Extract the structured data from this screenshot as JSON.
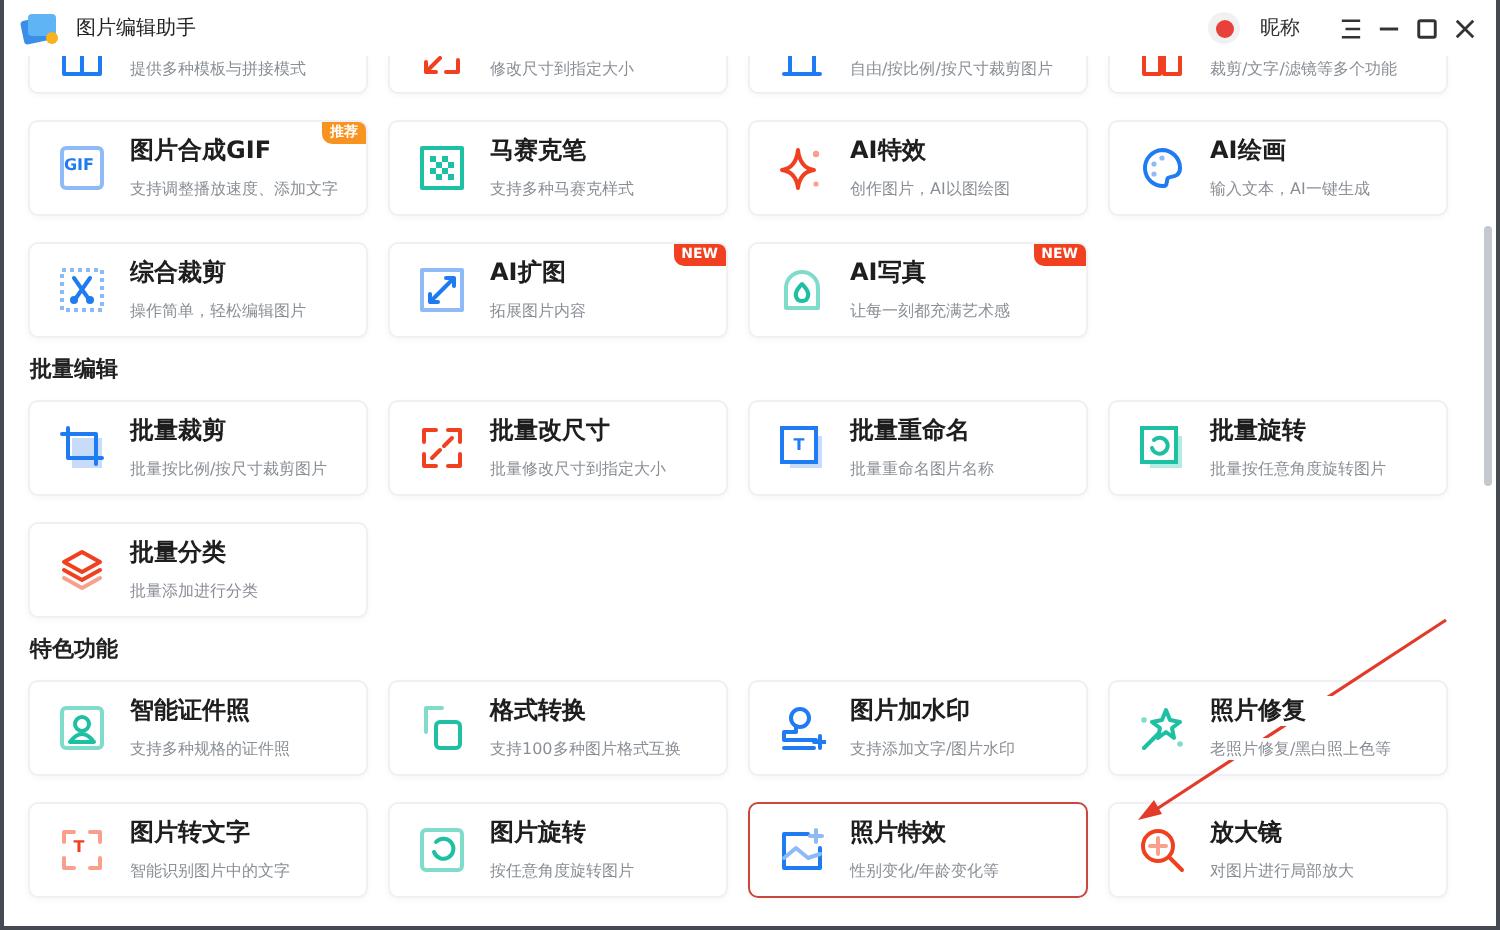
{
  "window": {
    "title": "图片编辑助手",
    "user_name": "昵称"
  },
  "sections": [
    {
      "items": [
        {
          "description": "提供多种模板与拼接模式",
          "selected": false
        },
        {
          "description": "修改尺寸到指定大小",
          "selected": false
        },
        {
          "description": "自由/按比例/按尺寸裁剪图片",
          "selected": false
        },
        {
          "description": "裁剪/文字/滤镜等多个功能",
          "selected": false
        },
        {
          "title": "图片合成GIF",
          "description": "支持调整播放速度、添加文字",
          "icon_label": "GIF",
          "badge": {
            "text": "推荐",
            "color": "#f7931e"
          },
          "selected": false
        },
        {
          "title": "马赛克笔",
          "description": "支持多种马赛克样式",
          "selected": false
        },
        {
          "title": "AI特效",
          "description": "创作图片，AI以图绘图",
          "selected": false
        },
        {
          "title": "AI绘画",
          "description": "输入文本，AI一键生成",
          "selected": false
        },
        {
          "title": "综合裁剪",
          "description": "操作简单，轻松编辑图片",
          "selected": false
        },
        {
          "title": "AI扩图",
          "description": "拓展图片内容",
          "badge": {
            "text": "NEW",
            "color": "#f0401f"
          },
          "selected": false
        },
        {
          "title": "AI写真",
          "description": "让每一刻都充满艺术感",
          "badge": {
            "text": "NEW",
            "color": "#f0401f"
          },
          "selected": false
        }
      ]
    },
    {
      "heading": "批量编辑",
      "items": [
        {
          "title": "批量裁剪",
          "description": "批量按比例/按尺寸裁剪图片",
          "selected": false
        },
        {
          "title": "批量改尺寸",
          "description": "批量修改尺寸到指定大小",
          "selected": false
        },
        {
          "title": "批量重命名",
          "description": "批量重命名图片名称",
          "icon_label": "T",
          "selected": false
        },
        {
          "title": "批量旋转",
          "description": "批量按任意角度旋转图片",
          "selected": false
        },
        {
          "title": "批量分类",
          "description": "批量添加进行分类",
          "selected": false
        }
      ]
    },
    {
      "heading": "特色功能",
      "items": [
        {
          "title": "智能证件照",
          "description": "支持多种规格的证件照",
          "selected": false
        },
        {
          "title": "格式转换",
          "description": "支持100多种图片格式互换",
          "selected": false
        },
        {
          "title": "图片加水印",
          "description": "支持添加文字/图片水印",
          "selected": false
        },
        {
          "title": "照片修复",
          "description": "老照片修复/黑白照上色等",
          "selected": false
        },
        {
          "title": "图片转文字",
          "description": "智能识别图片中的文字",
          "icon_label": "T",
          "selected": false
        },
        {
          "title": "图片旋转",
          "description": "按任意角度旋转图片",
          "selected": false
        },
        {
          "title": "照片特效",
          "description": "性别变化/年龄变化等",
          "selected": true
        },
        {
          "title": "放大镜",
          "description": "对图片进行局部放大",
          "selected": false
        }
      ]
    }
  ]
}
